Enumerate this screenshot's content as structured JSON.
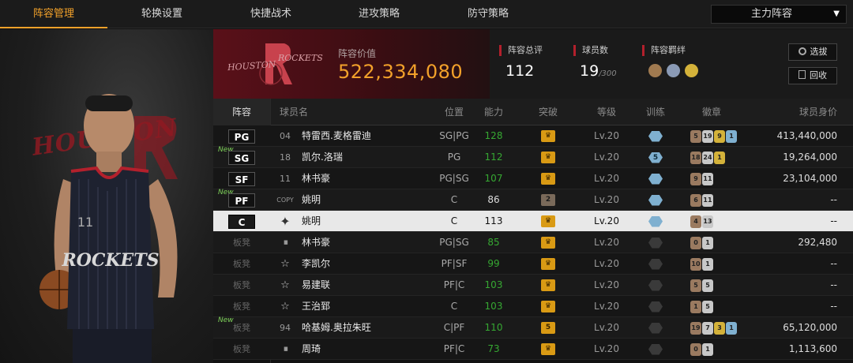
{
  "tabs": [
    {
      "label": "阵容管理",
      "active": true
    },
    {
      "label": "轮换设置",
      "active": false
    },
    {
      "label": "快捷战术",
      "active": false
    },
    {
      "label": "进攻策略",
      "active": false
    },
    {
      "label": "防守策略",
      "active": false
    }
  ],
  "lineup_select": {
    "value": "主力阵容",
    "icon": "caret-down-icon"
  },
  "team": {
    "logo_text_left": "HOUSTON",
    "logo_text_right": "ROCKETS",
    "value_label": "阵容价值",
    "value": "522,334,080"
  },
  "player_panel": {
    "jersey_text": "ROCKETS",
    "jersey_number": "11",
    "bg_text": "HOUSTON"
  },
  "stats": {
    "rating_label": "阵容总评",
    "rating_value": "112",
    "count_label": "球员数",
    "count_value": "19",
    "count_max": "/300",
    "bond_label": "阵容羁绊"
  },
  "buttons": {
    "pick": "选拔",
    "recycle": "回收"
  },
  "columns": [
    "阵容",
    "球员名",
    "位置",
    "能力",
    "突破",
    "等级",
    "训练",
    "徽章",
    "球员身价"
  ],
  "rows": [
    {
      "slot": "PG",
      "new": "",
      "num": "04",
      "name": "特雷西.麦格雷迪",
      "pos": "SG|PG",
      "ability": "128",
      "ability_color": "green",
      "break": "",
      "level": "Lv.20",
      "train": "",
      "badges": [
        "5",
        "19",
        "9",
        "1"
      ],
      "salary": "413,440,000"
    },
    {
      "slot": "SG",
      "new": "New",
      "num": "18",
      "name": "凯尔.洛瑞",
      "pos": "PG",
      "ability": "112",
      "ability_color": "green",
      "break": "",
      "level": "Lv.20",
      "train": "5",
      "badges": [
        "18",
        "24",
        "1"
      ],
      "salary": "19,264,000"
    },
    {
      "slot": "SF",
      "new": "",
      "num": "11",
      "name": "林书豪",
      "pos": "PG|SG",
      "ability": "107",
      "ability_color": "green",
      "break": "",
      "level": "Lv.20",
      "train": "",
      "badges": [
        "9",
        "11"
      ],
      "salary": "23,104,000"
    },
    {
      "slot": "PF",
      "new": "New",
      "num": "COPY",
      "name": "姚明",
      "pos": "C",
      "ability": "86",
      "ability_color": "white",
      "break": "2",
      "level": "Lv.20",
      "train": "",
      "badges": [
        "6",
        "11"
      ],
      "salary": "--"
    },
    {
      "slot": "C",
      "new": "",
      "num": "",
      "name": "姚明",
      "pos": "C",
      "ability": "113",
      "ability_color": "white",
      "break": "",
      "level": "Lv.20",
      "train": "",
      "badges": [
        "4",
        "13"
      ],
      "salary": "--"
    },
    {
      "slot": "板凳",
      "new": "",
      "num": "",
      "name": "林书豪",
      "pos": "PG|SG",
      "ability": "85",
      "ability_color": "green",
      "break": "",
      "level": "Lv.20",
      "train": "",
      "badges": [
        "0",
        "1"
      ],
      "salary": "292,480"
    },
    {
      "slot": "板凳",
      "new": "",
      "num": "",
      "name": "李凯尔",
      "pos": "PF|SF",
      "ability": "99",
      "ability_color": "green",
      "break": "",
      "level": "Lv.20",
      "train": "",
      "badges": [
        "10",
        "1"
      ],
      "salary": "--"
    },
    {
      "slot": "板凳",
      "new": "",
      "num": "",
      "name": "易建联",
      "pos": "PF|C",
      "ability": "103",
      "ability_color": "green",
      "break": "",
      "level": "Lv.20",
      "train": "",
      "badges": [
        "5",
        "5"
      ],
      "salary": "--"
    },
    {
      "slot": "板凳",
      "new": "",
      "num": "",
      "name": "王治郅",
      "pos": "C",
      "ability": "103",
      "ability_color": "green",
      "break": "",
      "level": "Lv.20",
      "train": "",
      "badges": [
        "1",
        "5"
      ],
      "salary": "--"
    },
    {
      "slot": "板凳",
      "new": "New",
      "num": "94",
      "name": "哈基姆.奥拉朱旺",
      "pos": "C|PF",
      "ability": "110",
      "ability_color": "green",
      "break": "5",
      "level": "Lv.20",
      "train": "",
      "badges": [
        "19",
        "7",
        "3",
        "1"
      ],
      "salary": "65,120,000"
    },
    {
      "slot": "板凳",
      "new": "",
      "num": "",
      "name": "周琦",
      "pos": "PF|C",
      "ability": "73",
      "ability_color": "green",
      "break": "",
      "level": "Lv.20",
      "train": "",
      "badges": [
        "0",
        "1"
      ],
      "salary": "1,113,600"
    }
  ]
}
